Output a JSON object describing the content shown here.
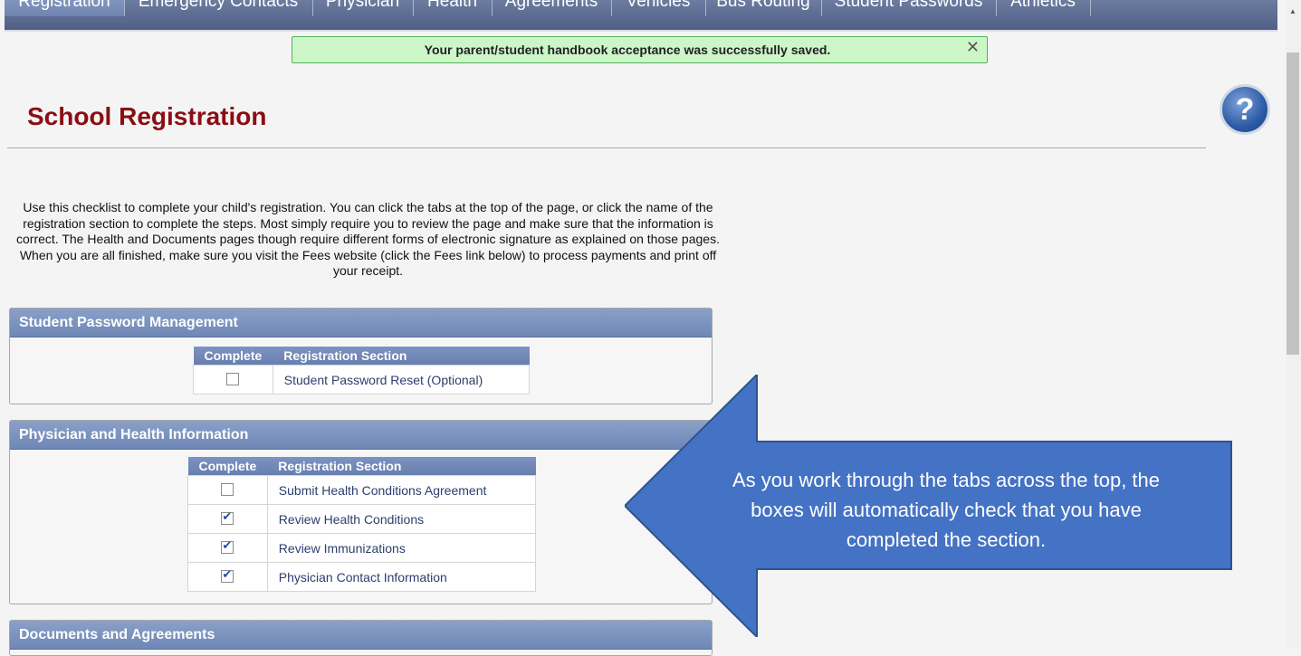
{
  "tabs": [
    {
      "label": "Registration",
      "active": true
    },
    {
      "label": "Emergency Contacts"
    },
    {
      "label": "Physician"
    },
    {
      "label": "Health"
    },
    {
      "label": "Agreements"
    },
    {
      "label": "Vehicles"
    },
    {
      "label": "Bus Routing"
    },
    {
      "label": "Student Passwords"
    },
    {
      "label": "Athletics"
    }
  ],
  "notice": {
    "text": "Your parent/student handbook acceptance was successfully saved.",
    "close": "✕"
  },
  "page_title": "School Registration",
  "help": {
    "label": "?"
  },
  "intro": "Use this checklist to complete your child's registration. You can click the tabs at the top of the page, or click the name of the registration section to complete the steps. Most simply require you to review the page and make sure that the information is correct. The Health and Documents pages though require different forms of electronic signature as explained on those pages. When you are all finished, make sure you visit the Fees website (click the Fees link below) to process payments and print off your receipt.",
  "sections": [
    {
      "title": "Student Password Management",
      "col_complete": "Complete",
      "col_section": "Registration Section",
      "rows": [
        {
          "label": "Student Password Reset (Optional)",
          "checked": false
        }
      ]
    },
    {
      "title": "Physician and Health Information",
      "col_complete": "Complete",
      "col_section": "Registration Section",
      "rows": [
        {
          "label": "Submit Health Conditions Agreement",
          "checked": false
        },
        {
          "label": "Review Health Conditions",
          "checked": true
        },
        {
          "label": "Review Immunizations",
          "checked": true
        },
        {
          "label": "Physician Contact Information",
          "checked": true
        }
      ]
    },
    {
      "title": "Documents and Agreements"
    }
  ],
  "callout": {
    "line1": "As you work through the tabs across the top, the",
    "line2": "boxes will automatically check that you have",
    "line3": "completed the section.",
    "color": "#4472c4"
  },
  "icons": {
    "help": "help-icon",
    "close": "close-icon",
    "checkbox": "checkbox-icon"
  }
}
